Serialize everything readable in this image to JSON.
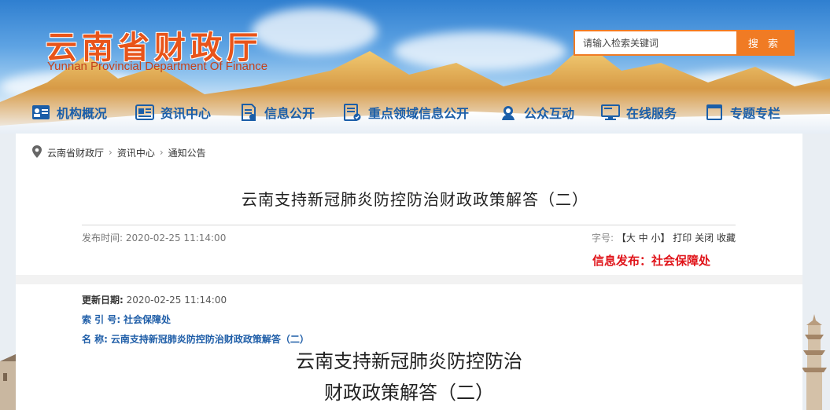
{
  "site": {
    "name_cn": "云南省财政厅",
    "name_en": "Yunnan Provincial Department Of Finance"
  },
  "search": {
    "placeholder": "请输入检索关键词",
    "button_label": "搜 索"
  },
  "nav": {
    "items": [
      {
        "label": "机构概况",
        "icon": "org-chart-icon"
      },
      {
        "label": "资讯中心",
        "icon": "news-icon"
      },
      {
        "label": "信息公开",
        "icon": "document-icon"
      },
      {
        "label": "重点领域信息公开",
        "icon": "key-info-icon"
      },
      {
        "label": "公众互动",
        "icon": "chat-icon"
      },
      {
        "label": "在线服务",
        "icon": "monitor-icon"
      },
      {
        "label": "专题专栏",
        "icon": "column-icon"
      }
    ]
  },
  "breadcrumb": {
    "items": [
      "云南省财政厅",
      "资讯中心",
      "通知公告"
    ],
    "separator": "›"
  },
  "article": {
    "page_title": "云南支持新冠肺炎防控防治财政政策解答（二）",
    "publish_label": "发布时间:",
    "publish_time": "2020-02-25 11:14:00",
    "font_label": "字号:",
    "font_options": "【大 中 小】",
    "print": "打印",
    "close": "关闭",
    "favorite": "收藏",
    "publisher": "信息发布：社会保障处",
    "update_label": "更新日期:",
    "update_time": "2020-02-25 11:14:00",
    "index_label": "索 引 号:",
    "index_value": "社会保障处",
    "name_label": "名 称:",
    "name_value": "云南支持新冠肺炎防控防治财政政策解答（二）",
    "body_title_line1": "云南支持新冠肺炎防控防治",
    "body_title_line2": "财政政策解答（二）"
  },
  "colors": {
    "brand_orange": "#e8541a",
    "nav_blue": "#1b5ea8",
    "publisher_red": "#e0141a",
    "search_orange": "#f07b24"
  }
}
